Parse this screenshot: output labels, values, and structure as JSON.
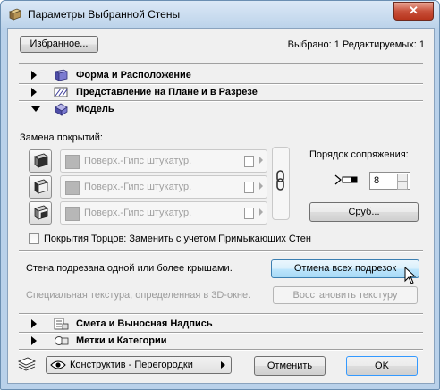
{
  "window": {
    "title": "Параметры Выбранной Стены",
    "close_glyph": "✕"
  },
  "toolbar": {
    "favorites_label": "Избранное...",
    "selection_status": "Выбрано: 1 Редактируемых: 1"
  },
  "panels": {
    "form": "Форма и Расположение",
    "plan": "Представление на Плане и в Разрезе",
    "model": "Модель",
    "listing": "Смета и Выносная Надпись",
    "tags": "Метки и Категории"
  },
  "model": {
    "surfaces_label": "Замена покрытий:",
    "surfaces": [
      {
        "value": "Поверх.-Гипс штукатур.",
        "icon": "wall-face-icon"
      },
      {
        "value": "Поверх.-Гипс штукатур.",
        "icon": "wall-side-icon"
      },
      {
        "value": "Поверх.-Гипс штукатур.",
        "icon": "wall-back-icon"
      }
    ],
    "junction_label": "Порядок сопряжения:",
    "junction_value": "8",
    "log_button": "Сруб...",
    "edges_checkbox_label": "Покрытия Торцов: Заменить с учетом Примыкающих Стен",
    "edges_checked": false,
    "trim_info": "Стена подрезана одной или более крышами.",
    "cancel_trims_button": "Отмена всех подрезок",
    "texture_info": "Специальная текстура, определенная в 3D-окне.",
    "restore_texture_button": "Восстановить текстуру"
  },
  "footer": {
    "layer_value": "Конструктив - Перегородки",
    "cancel_label": "Отменить",
    "ok_label": "OK"
  },
  "colors": {
    "titlebar": "#bcd3ea",
    "close_button": "#c8503a",
    "client_background": "#f0f0f0",
    "hot_button": "#bee6fd"
  }
}
